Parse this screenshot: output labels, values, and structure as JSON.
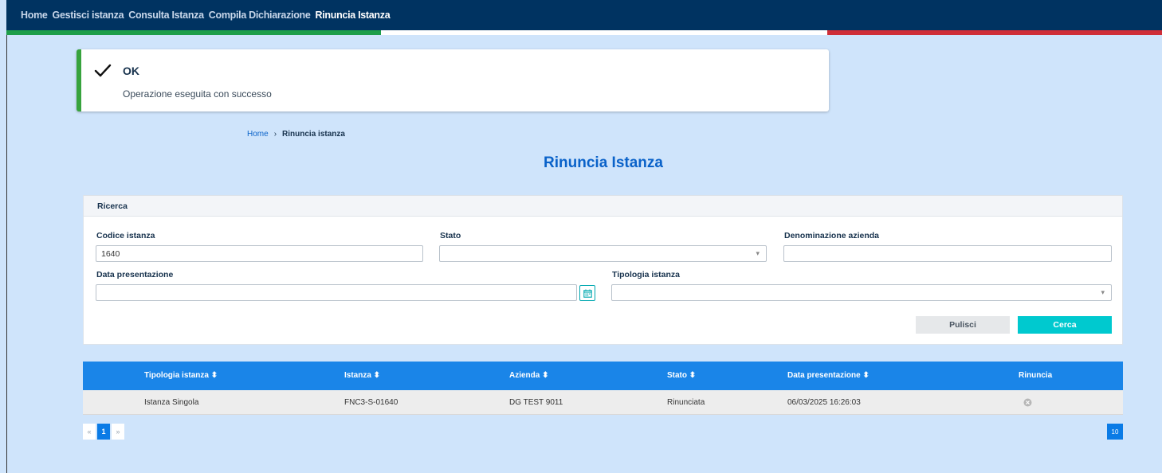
{
  "nav": {
    "items": [
      "Home",
      "Gestisci istanza",
      "Consulta Istanza",
      "Compila Dichiarazione",
      "Rinuncia Istanza"
    ],
    "active_index": 4
  },
  "alert": {
    "title": "OK",
    "message": "Operazione eseguita con successo",
    "icon": "check-icon",
    "accent": "#38a33d"
  },
  "breadcrumb": {
    "home": "Home",
    "separator": "›",
    "current": "Rinuncia istanza"
  },
  "page_title": "Rinuncia Istanza",
  "search": {
    "panel_title": "Ricerca",
    "fields": {
      "codice_label": "Codice istanza",
      "codice_value": "1640",
      "stato_label": "Stato",
      "stato_value": "",
      "denominazione_label": "Denominazione azienda",
      "denominazione_value": "",
      "data_label": "Data presentazione",
      "data_value": "",
      "tipologia_label": "Tipologia istanza",
      "tipologia_value": ""
    },
    "clear_label": "Pulisci",
    "search_label": "Cerca"
  },
  "table": {
    "columns": [
      "Tipologia istanza ⬍",
      "Istanza ⬍",
      "Azienda ⬍",
      "Stato ⬍",
      "Data presentazione ⬍",
      "Rinuncia"
    ],
    "rows": [
      [
        "Istanza Singola",
        "FNC3-S-01640",
        "DG TEST 9011",
        "Rinunciata",
        "06/03/2025 16:26:03",
        ""
      ]
    ]
  },
  "pagination": {
    "prev": "«",
    "current": "1",
    "next": "»",
    "page_size": "10"
  },
  "colors": {
    "nav_bg": "#003361",
    "header_blue": "#1a85e8",
    "primary_button": "#00c9cf",
    "page_bg": "#cfe4fb"
  }
}
